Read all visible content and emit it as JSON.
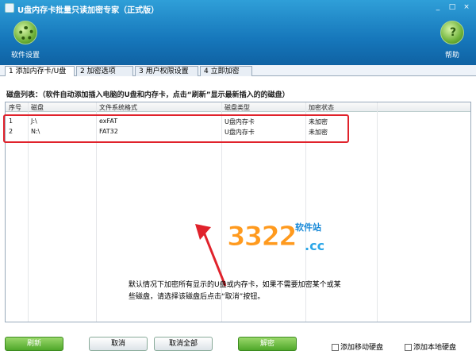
{
  "window": {
    "title": "U盘内存卡批量只读加密专家（正式版）",
    "controls": [
      "_",
      "□",
      "×"
    ]
  },
  "header": {
    "settings_label": "软件设置",
    "help_label": "帮助",
    "help_glyph": "?"
  },
  "tabs": [
    {
      "label": "1 添加内存卡/U盘",
      "active": true
    },
    {
      "label": "2 加密选项",
      "active": false
    },
    {
      "label": "3 用户权限设置",
      "active": false
    },
    {
      "label": "4 立即加密",
      "active": false
    }
  ],
  "instruction": "磁盘列表：（软件自动添加插入电脑的U盘和内存卡，点击“刷新”显示最新插入的的磁盘）",
  "table": {
    "headers": [
      "序号",
      "磁盘",
      "文件系统格式",
      "磁盘类型",
      "加密状态"
    ],
    "rows": [
      [
        "1",
        "J:\\",
        "exFAT",
        "U盘内存卡",
        "未加密"
      ],
      [
        "2",
        "N:\\",
        "FAT32",
        "U盘内存卡",
        "未加密"
      ]
    ]
  },
  "note": "默认情况下加密所有显示的U盘或内存卡，如果不需要加密某个或某些磁盘，请选择该磁盘后点击“取消”按钮。",
  "watermark": {
    "number": "3322",
    "suffix": ".cc",
    "site": "软件站"
  },
  "buttons": {
    "refresh": "刷新",
    "cancel": "取消",
    "cancel_all": "取消全部",
    "decrypt": "解密"
  },
  "checkboxes": {
    "add_mobile": "添加移动硬盘",
    "add_local": "添加本地硬盘"
  },
  "colors": {
    "header_blue": "#1677bb",
    "highlight_red": "#e0222b",
    "button_green": "#4fa72a"
  }
}
